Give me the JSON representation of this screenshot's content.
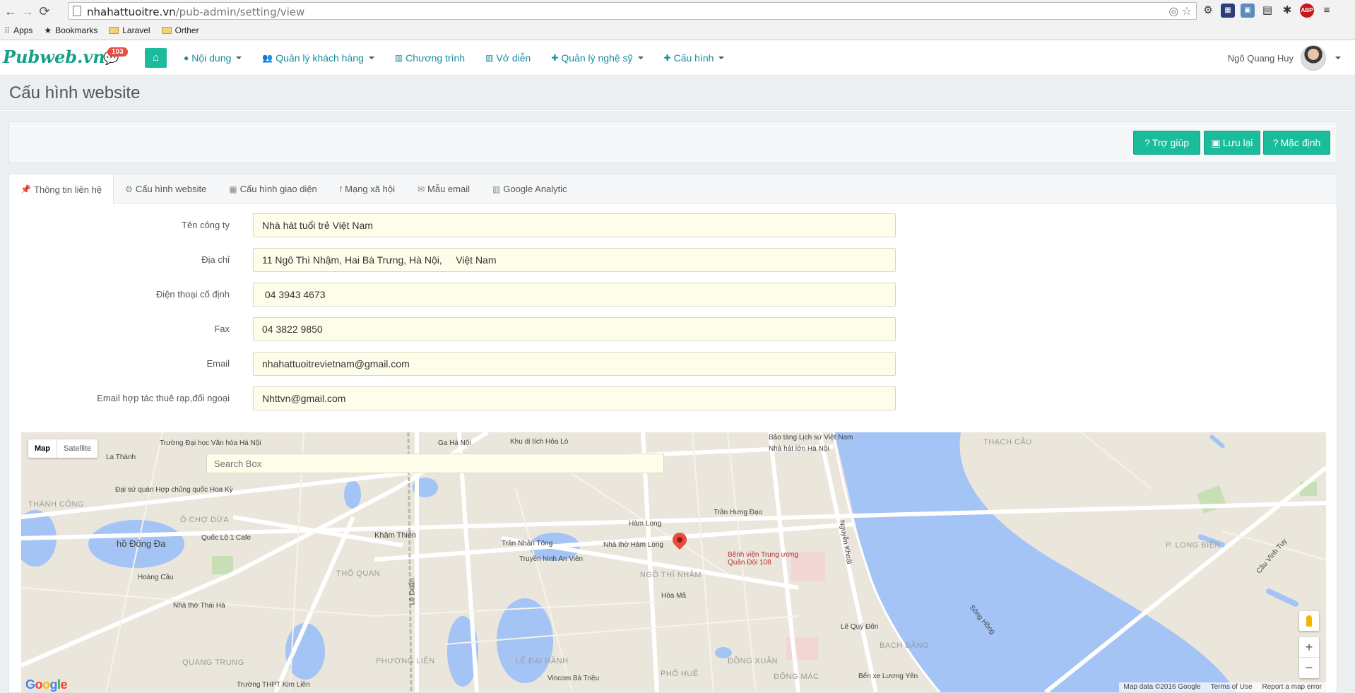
{
  "browser": {
    "url_host": "nhahattuoitre.vn",
    "url_path": "/pub-admin/setting/view",
    "bookmarks": [
      "Apps",
      "Bookmarks",
      "Laravel",
      "Orther"
    ],
    "ext_abp": "ABP"
  },
  "navbar": {
    "brand": "Pubweb.vn",
    "message_count": "103",
    "menu": [
      {
        "label": "Nội dung",
        "icon": "globe-icon",
        "dropdown": true
      },
      {
        "label": "Quản lý khách hàng",
        "icon": "users-icon",
        "dropdown": true
      },
      {
        "label": "Chương trình",
        "icon": "chart-icon",
        "dropdown": false
      },
      {
        "label": "Vở diễn",
        "icon": "chart-icon",
        "dropdown": false
      },
      {
        "label": "Quản lý nghệ sỹ",
        "icon": "puzzle-icon",
        "dropdown": true
      },
      {
        "label": "Cấu hình",
        "icon": "puzzle-icon",
        "dropdown": true
      }
    ],
    "user_name": "Ngô Quang Huy"
  },
  "page": {
    "title": "Cấu hình website"
  },
  "toolbar": {
    "help_label": "Trợ giúp",
    "save_label": "Lưu lại",
    "default_label": "Mặc định"
  },
  "tabs": [
    {
      "label": "Thông tin liên hệ",
      "icon": "pin-icon",
      "active": true
    },
    {
      "label": "Cấu hình website",
      "icon": "gears-icon",
      "active": false
    },
    {
      "label": "Cấu hình giao diện",
      "icon": "grid-icon",
      "active": false
    },
    {
      "label": "Mạng xã hội",
      "icon": "facebook-icon",
      "active": false
    },
    {
      "label": "Mẫu email",
      "icon": "envelope-icon",
      "active": false
    },
    {
      "label": "Google Analytic",
      "icon": "chart-icon",
      "active": false
    }
  ],
  "form": {
    "company_label": "Tên công ty",
    "company_value": "Nhà hát tuổi trẻ Việt Nam",
    "address_label": "Địa chỉ",
    "address_value": "11 Ngô Thì Nhậm, Hai Bà Trưng, Hà Nội,     Việt Nam",
    "phone_label": "Điện thoại cố định",
    "phone_value": " 04 3943 4673",
    "fax_label": "Fax",
    "fax_value": "04 3822 9850",
    "email_label": "Email",
    "email_value": "nhahattuoitrevietnam@gmail.com",
    "email2_label": "Email hợp tác thuê rạp,đối ngoại",
    "email2_value": "Nhttvn@gmail.com"
  },
  "map": {
    "type_map": "Map",
    "type_satellite": "Satellite",
    "search_placeholder": "Search Box",
    "zoom_in": "+",
    "zoom_out": "−",
    "footer_data": "Map data ©2016 Google",
    "footer_terms": "Terms of Use",
    "footer_report": "Report a map error",
    "labels": {
      "l1": "Trường Đại học Văn hóa Hà Nội",
      "l2": "Ga Hà Nội",
      "l3": "Khu di tích Hỏa Lò",
      "l4": "Nhà hát lớn Hà Nội",
      "l5": "Bảo tàng Lịch sử Việt Nam",
      "l6": "La Thành",
      "l7": "Đại sứ quán Hợp chủng quốc Hoa Kỳ",
      "l8": "THÀNH CÔNG",
      "l9": "Ô CHỢ DỪA",
      "l10": "Quốc Lộ 1 Cafe",
      "l11": "hồ Đống Đa",
      "l12": "Khâm Thiên",
      "l13": "Nhà thờ Hàm Long",
      "l14": "Truyền hình An Viên",
      "l15": "NGÔ THÌ NHẬM",
      "l16": "Bệnh viện Trung ương Quân Đội 108",
      "l17": "THỔ QUAN",
      "l18": "Nhà thờ Thái Hà",
      "l19": "QUANG TRUNG",
      "l20": "PHƯƠNG LIÊN",
      "l21": "LÊ ĐẠI HÀNH",
      "l22": "Vincom Bà Triệu",
      "l23": "PHỐ HUẾ",
      "l24": "ĐỒNG XUÂN",
      "l25": "ĐỐNG MÁC",
      "l26": "BẠCH ĐẰNG",
      "l27": "Sông Hồng",
      "l28": "THẠCH CẦU",
      "l29": "P. LONG BIÊN",
      "l30": "Bến xe Lương Yên",
      "l31": "Trường THPT Kim Liên",
      "l32": "Trần Hưng Đạo",
      "l33": "Hàm Long",
      "l34": "Hòa Mã",
      "l35": "Lê Duẩn",
      "l36": "Trần Nhân Tông",
      "l37": "Hoàng Cầu",
      "l38": "Nguyễn Khoái",
      "l39": "Lê Quý Đôn",
      "l40": "Cầu Vĩnh Tuy"
    }
  }
}
